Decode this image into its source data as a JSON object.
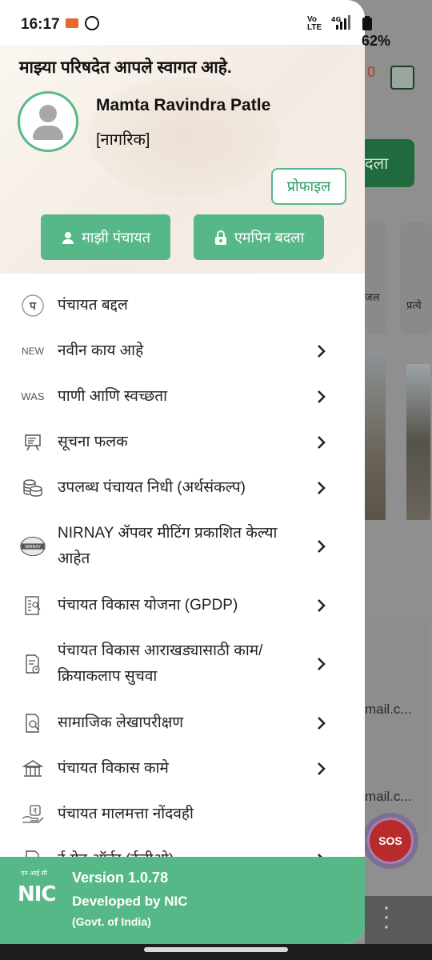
{
  "status_bar": {
    "time": "16:17",
    "network": "4G",
    "volte": "Vo LTE",
    "battery": "62%"
  },
  "header": {
    "welcome": "माझ्या परिषदेत आपले स्वागत आहे.",
    "user_name": "Mamta Ravindra Patle",
    "user_role": "[नागरिक]",
    "profile_label": "प्रोफाइल",
    "my_panchayat_label": "माझी पंचायत",
    "change_mpin_label": "एमपिन बदला"
  },
  "menu": [
    {
      "label": "पंचायत बद्दल",
      "icon": "panchayat-logo-icon",
      "icon_text": "प",
      "chevron": false
    },
    {
      "label": "नवीन काय आहे",
      "icon": "new-icon",
      "icon_text": "NEW",
      "chevron": true
    },
    {
      "label": "पाणी आणि स्वच्छता",
      "icon": "was-icon",
      "icon_text": "WAS",
      "chevron": true
    },
    {
      "label": "सूचना फलक",
      "icon": "notice-board-icon",
      "icon_text": "",
      "chevron": true
    },
    {
      "label": "उपलब्ध पंचायत निधी (अर्थसंकल्प)",
      "icon": "coins-icon",
      "icon_text": "",
      "chevron": true
    },
    {
      "label": "NIRNAY ॲपवर मीटिंग प्रकाशित केल्या आहेत",
      "icon": "nirnay-icon",
      "icon_text": "NIRNAY",
      "chevron": true
    },
    {
      "label": "पंचायत विकास योजना (GPDP)",
      "icon": "plan-document-icon",
      "icon_text": "",
      "chevron": true
    },
    {
      "label": "पंचायत विकास आराखड्यासाठी काम/क्रियाकलाप सुचवा",
      "icon": "suggest-document-icon",
      "icon_text": "",
      "chevron": true
    },
    {
      "label": "सामाजिक लेखापरीक्षण",
      "icon": "audit-search-icon",
      "icon_text": "",
      "chevron": true
    },
    {
      "label": "पंचायत विकास कामे",
      "icon": "building-icon",
      "icon_text": "",
      "chevron": true
    },
    {
      "label": "पंचायत मालमत्ता नोंदवही",
      "icon": "asset-register-icon",
      "icon_text": "",
      "chevron": false
    },
    {
      "label": "ई-ग्रेन ऑर्डर (ईजीओ)",
      "icon": "document-icon",
      "icon_text": "",
      "chevron": true
    }
  ],
  "footer": {
    "nic_small": "एन आई सी",
    "nic_logo": "NIC",
    "version": "Version 1.0.78",
    "developer": "Developed by NIC",
    "gov": "(Govt. of India)"
  },
  "background": {
    "badge": "0",
    "button_fragment": "दला",
    "label_a": "जल",
    "label_b": "प्रत्ये",
    "mail_a": "mail.c...",
    "mail_b": "mail.c...",
    "sos": "SOS"
  },
  "colors": {
    "accent_green": "#56b888",
    "scrim": "#8f8f8f",
    "sos_red": "#b82b2b"
  }
}
